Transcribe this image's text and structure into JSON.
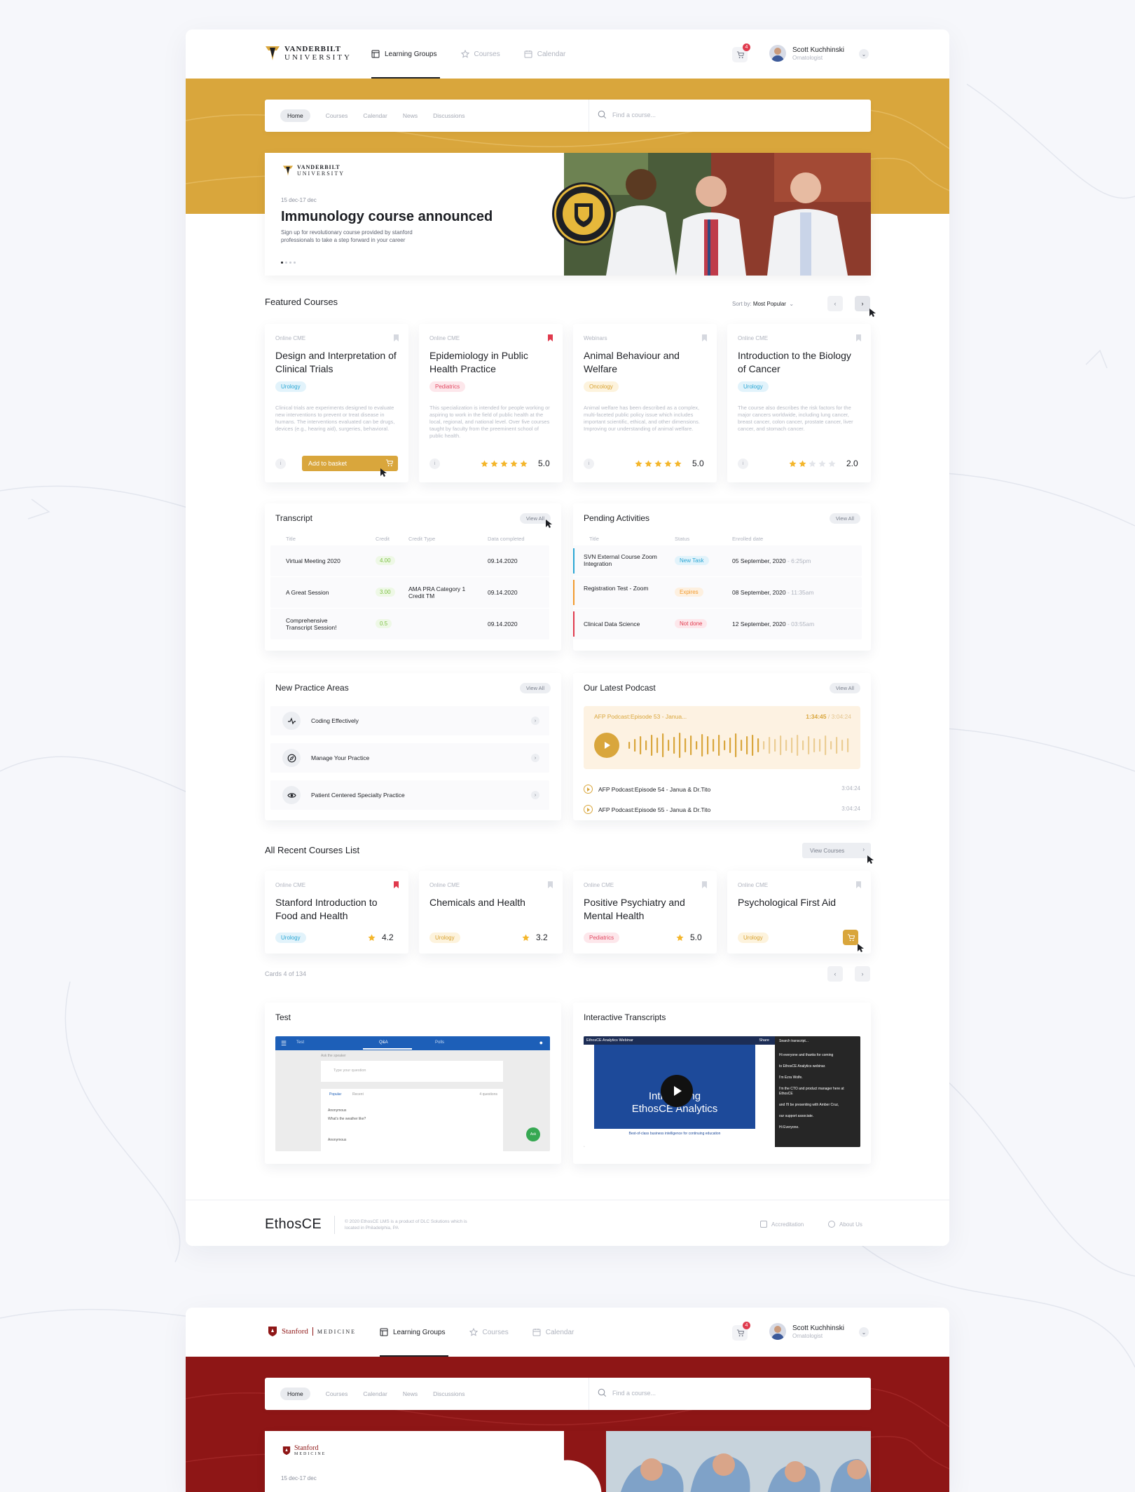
{
  "brand_colors": {
    "vanderbilt_gold": "#d9a63c",
    "stanford_red": "#8e1616",
    "accent_red": "#e03a4d",
    "urology_blue": "#2aa6d4",
    "pediatrics_pink": "#e24a63",
    "credit_green": "#7cc144"
  },
  "vanderbilt": {
    "logo": {
      "line1": "VANDERBILT",
      "line2": "UNIVERSITY"
    },
    "nav": [
      {
        "label": "Learning Groups",
        "icon": "grid-icon",
        "active": true
      },
      {
        "label": "Courses",
        "icon": "star-icon"
      },
      {
        "label": "Calendar",
        "icon": "calendar-icon"
      }
    ],
    "cart_count": "4",
    "user": {
      "name": "Scott Kuchhinski",
      "role": "Ornatologist"
    },
    "subnav": [
      "Home",
      "Courses",
      "Calendar",
      "News",
      "Discussions"
    ],
    "search_placeholder": "Find a course...",
    "banner": {
      "logo_line1": "VANDERBILT",
      "logo_line2": "UNIVERSITY",
      "date": "15 dec-17 dec",
      "title": "Immunology course announced",
      "subtitle": "Sign up for revolutionary course provided by stanford professionals to take a step forward in your career",
      "slide": 1,
      "slides": 4
    }
  },
  "featured": {
    "title": "Featured Courses",
    "sort_label": "Sort by:",
    "sort_value": "Most Popular",
    "cards": [
      {
        "type": "Online CME",
        "title": "Design and Interpretation of Clinical Trials",
        "tag": "Urology",
        "desc": "Clinical trials are experiments designed to evaluate new interventions to prevent or treat disease in humans. The interventions evaluated can be drugs, devices (e.g., hearing aid), surgeries, behavioral.",
        "button": "Add to basket",
        "bookmarked": false
      },
      {
        "type": "Online CME",
        "title": "Epidemiology in Public Health Practice",
        "tag": "Pediatrics",
        "desc": "This specialization is intended for people working or aspiring to work in the field of public health at the local, regional, and national level. Over five courses taught by faculty from the preeminent school of public health.",
        "rating": "5.0",
        "stars": 5,
        "bookmarked": true
      },
      {
        "type": "Webinars",
        "title": "Animal Behaviour and Welfare",
        "tag": "Oncology",
        "desc": "Animal welfare has been described as a complex, multi-faceted public policy issue which includes important scientific, ethical, and other dimensions. Improving our understanding of animal welfare.",
        "rating": "5.0",
        "stars": 5,
        "bookmarked": false
      },
      {
        "type": "Online CME",
        "title": "Introduction to the Biology of Cancer",
        "tag": "Urology",
        "desc": "The course also describes the risk factors for the major cancers worldwide, including lung cancer, breast cancer, colon cancer, prostate cancer, liver cancer, and stomach cancer.",
        "rating": "2.0",
        "stars": 2,
        "bookmarked": false
      }
    ]
  },
  "transcript": {
    "title": "Transcript",
    "view_all": "View All",
    "headers": [
      "Title",
      "Credit",
      "Credit Type",
      "Data completed"
    ],
    "rows": [
      {
        "title": "Virtual Meeting 2020",
        "credit": "4.00",
        "credit_type": "",
        "date": "09.14.2020"
      },
      {
        "title": "A Great Session",
        "credit": "3.00",
        "credit_type": "AMA PRA Category 1 Credit TM",
        "date": "09.14.2020"
      },
      {
        "title": "Comprehensive Transcript Session!",
        "credit": "0.5",
        "credit_type": "",
        "date": "09.14.2020"
      }
    ]
  },
  "pending": {
    "title": "Pending Activities",
    "view_all": "View All",
    "headers": [
      "Title",
      "Status",
      "Enrolled date"
    ],
    "rows": [
      {
        "title": "SVN External Course Zoom Integration",
        "status": "New Task",
        "date": "05 September, 2020",
        "time": "- 6:25pm",
        "color": "#2aa6d4"
      },
      {
        "title": "Registration Test - Zoom",
        "status": "Expires",
        "date": "08 September, 2020",
        "time": "- 11:35am",
        "color": "#f29a2e"
      },
      {
        "title": "Clinical Data Science",
        "status": "Not done",
        "date": "12 September, 2020",
        "time": "- 03:55am",
        "color": "#e03a4d"
      }
    ]
  },
  "practice": {
    "title": "New Practice Areas",
    "view_all": "View All",
    "items": [
      {
        "label": "Coding Effectively",
        "icon": "pulse-icon"
      },
      {
        "label": "Manage Your Practice",
        "icon": "compass-icon"
      },
      {
        "label": "Patient Centered Specialty Practice",
        "icon": "eye-icon"
      }
    ]
  },
  "podcast": {
    "title": "Our Latest Podcast",
    "view_all": "View All",
    "now_playing": "AFP Podcast:Episode 53 - Janua...",
    "elapsed": "1:34:45",
    "total": "/ 3:04:24",
    "episodes": [
      {
        "title": "AFP Podcast:Episode 54 - Janua & Dr.Tito",
        "length": "3:04:24"
      },
      {
        "title": "AFP Podcast:Episode 55 - Janua & Dr.Tito",
        "length": "3:04:24"
      }
    ]
  },
  "recent": {
    "title": "All Recent Courses List",
    "view_courses": "View Courses",
    "count_label": "Cards 4 of 134",
    "cards": [
      {
        "type": "Online CME",
        "title": "Stanford Introduction to Food and Health",
        "tag": "Urology",
        "rating": "4.2",
        "bookmarked": true
      },
      {
        "type": "Online CME",
        "title": "Chemicals and Health",
        "tag": "Urology",
        "rating": "3.2",
        "bookmarked": false
      },
      {
        "type": "Online CME",
        "title": "Positive Psychiatry and Mental Health",
        "tag": "Pediatrics",
        "rating": "5.0",
        "bookmarked": false
      },
      {
        "type": "Online CME",
        "title": "Psychological First Aid",
        "tag": "Urology",
        "bookmarked": false
      }
    ]
  },
  "test": {
    "title": "Test",
    "app_tabs": [
      "Test",
      "Q&A",
      "Polls"
    ],
    "ask_label": "Ask the speaker",
    "question_placeholder": "Type your question",
    "filter_tabs": [
      "Popular",
      "Recent"
    ],
    "questions_count": "4 questions",
    "author": "Anonymous",
    "question": "What's the weather like?",
    "ask_button": "Ask"
  },
  "interactive": {
    "title": "Interactive Transcripts",
    "video_title": "EthosCE Analytics Webinar",
    "share": "Share",
    "overlay_line1": "Introducing",
    "overlay_line2": "EthosCE Analytics",
    "overlay_caption": "Best-of-class business intelligence for continuing education",
    "transcript_search": "Search transcript...",
    "lines": [
      "Hi everyone and thanks for coming",
      "to EthosCE Analytics webinar.",
      "I'm Ezra Wolfe.",
      "I'm the CTO and product manager here at EthosCE",
      "and I'll be presenting with Amber Cruz,",
      "our support associate.",
      "Hi Everyone."
    ]
  },
  "footer": {
    "brand": "EthosCE",
    "copyright": "© 2020 EthosCE LMS is a product of DLC Solutions which is located in Philadelphia, PA",
    "links": [
      "Accreditation",
      "About Us"
    ]
  },
  "stanford": {
    "logo": {
      "line1": "Stanford",
      "line2": "MEDICINE"
    },
    "nav": [
      {
        "label": "Learning Groups",
        "icon": "grid-icon",
        "active": true
      },
      {
        "label": "Courses",
        "icon": "star-icon"
      },
      {
        "label": "Calendar",
        "icon": "calendar-icon"
      }
    ],
    "cart_count": "4",
    "user": {
      "name": "Scott Kuchhinski",
      "role": "Ornatologist"
    },
    "subnav": [
      "Home",
      "Courses",
      "Calendar",
      "News",
      "Discussions"
    ],
    "search_placeholder": "Find a course...",
    "banner": {
      "logo_line1": "Stanford",
      "logo_line2": "MEDICINE",
      "date": "15 dec-17 dec"
    }
  }
}
